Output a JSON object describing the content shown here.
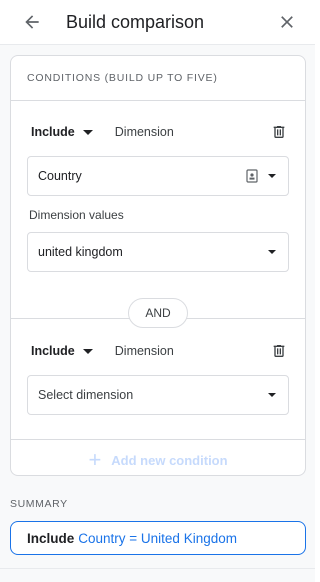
{
  "header": {
    "title": "Build comparison"
  },
  "conditions": {
    "title": "CONDITIONS (BUILD UP TO FIVE)",
    "items": [
      {
        "include_label": "Include",
        "dimension_label": "Dimension",
        "dimension_value": "Country",
        "values_label": "Dimension values",
        "values_value": "united kingdom"
      },
      {
        "include_label": "Include",
        "dimension_label": "Dimension",
        "dimension_placeholder": "Select dimension"
      }
    ],
    "and_label": "AND",
    "add_label": "Add new condition"
  },
  "summary": {
    "title": "SUMMARY",
    "include": "Include",
    "value": "Country = United Kingdom"
  },
  "colors": {
    "accent": "#1a73e8",
    "disabled": "#c6dafc",
    "border": "#dadce0"
  },
  "icons": {
    "back": "arrow-back-icon",
    "close": "close-icon",
    "trash": "trash-icon",
    "id_badge": "id-badge-icon",
    "plus": "plus-icon"
  }
}
